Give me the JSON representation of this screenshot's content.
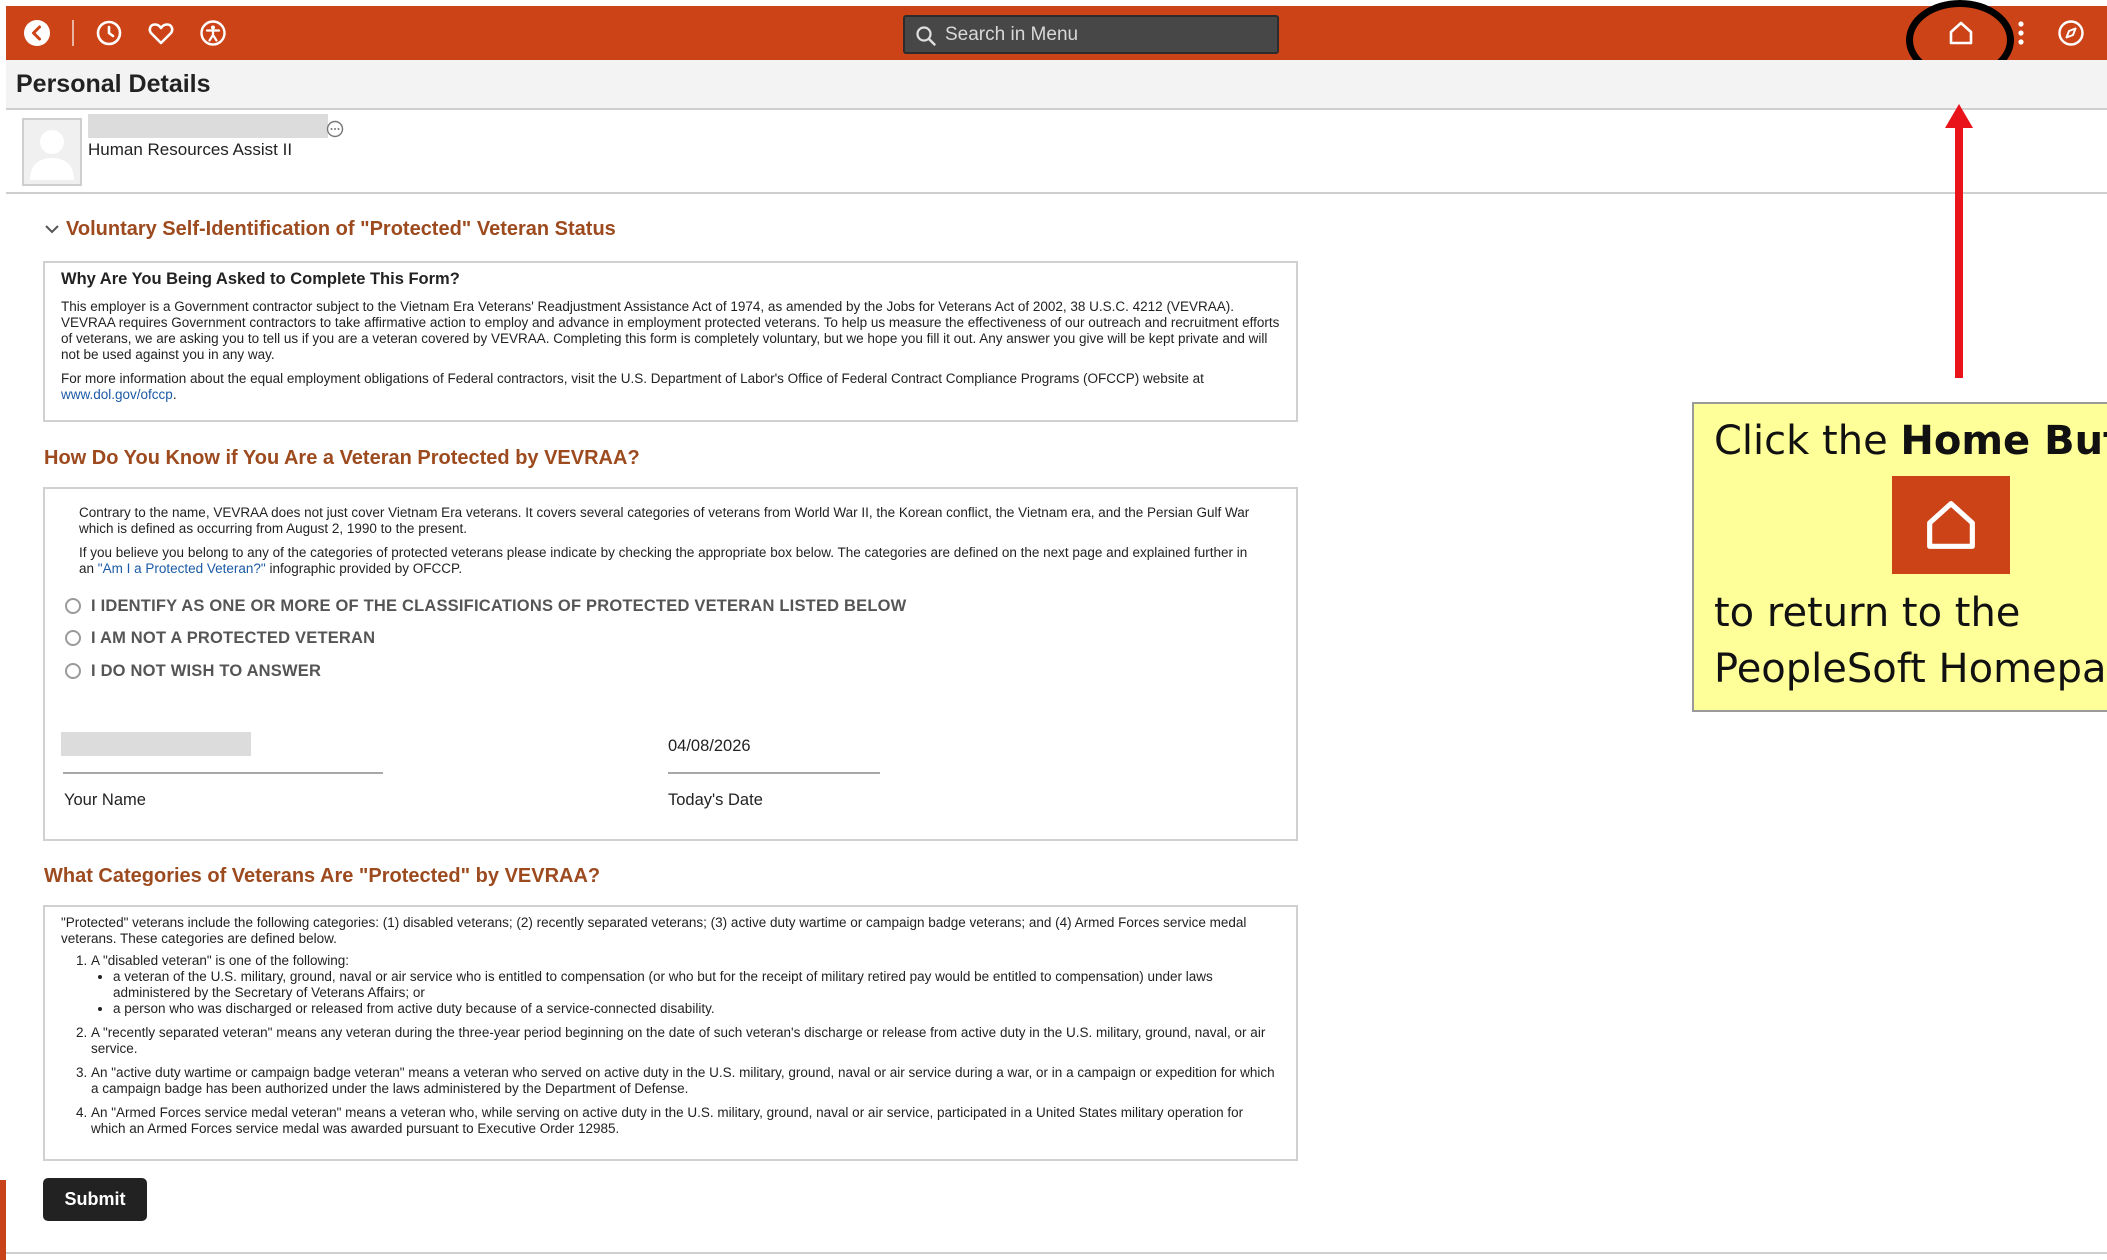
{
  "header": {
    "search_placeholder": "Search in Menu"
  },
  "page": {
    "title": "Personal Details",
    "job_title": "Human Resources Assist II"
  },
  "section1": {
    "heading": "Voluntary Self-Identification of \"Protected\" Veteran Status",
    "box_title": "Why Are You Being Asked to Complete This Form?",
    "para1": "This employer is a Government contractor subject to the Vietnam Era Veterans' Readjustment Assistance Act of 1974, as amended by the Jobs for Veterans Act of 2002, 38 U.S.C. 4212 (VEVRAA). VEVRAA requires Government contractors to take affirmative action to employ and advance in employment protected veterans. To help us measure the effectiveness of our outreach and recruitment efforts of veterans, we are asking you to tell us if you are a veteran covered by VEVRAA. Completing this form is completely voluntary, but we hope you fill it out. Any answer you give will be kept private and will not be used against you in any way.",
    "para2_pre": "For more information about the equal employment obligations of Federal contractors, visit the U.S. Department of Labor's Office of Federal Contract Compliance Programs (OFCCP) website at ",
    "para2_link": "www.dol.gov/ofccp",
    "para2_post": "."
  },
  "section2": {
    "heading": "How Do You Know if You Are a Veteran Protected by VEVRAA?",
    "para1": "Contrary to the name, VEVRAA does not just cover Vietnam Era veterans. It covers several categories of veterans from World War II, the Korean conflict, the Vietnam era, and the Persian Gulf War which is defined as occurring from August 2, 1990 to the present.",
    "para2_pre": "If you believe you belong to any of the categories of protected veterans please indicate by checking the appropriate box below. The categories are defined on the next page and explained further in an ",
    "para2_link": "\"Am I a Protected Veteran?\"",
    "para2_post": " infographic provided by OFCCP.",
    "options": [
      "I IDENTIFY AS ONE OR MORE OF THE CLASSIFICATIONS OF PROTECTED VETERAN LISTED BELOW",
      "I AM NOT A PROTECTED VETERAN",
      "I DO NOT WISH TO ANSWER"
    ],
    "date_value": "04/08/2026",
    "name_label": "Your Name",
    "date_label": "Today's Date"
  },
  "section3": {
    "heading": "What Categories of Veterans Are \"Protected\" by VEVRAA?",
    "intro": "\"Protected\" veterans include the following categories: (1) disabled veterans; (2) recently separated veterans; (3) active duty wartime or campaign badge veterans; and (4) Armed Forces service medal veterans. These categories are defined below.",
    "item1": "A \"disabled veteran\" is one of the following:",
    "item1_bullets": [
      "a veteran of the U.S. military, ground, naval or air service who is entitled to compensation (or who but for the receipt of military retired pay would be entitled to compensation) under laws administered by the Secretary of Veterans Affairs; or",
      "a person who was discharged or released from active duty because of a service-connected disability."
    ],
    "item2": "A \"recently separated veteran\" means any veteran during the three-year period beginning on the date of such veteran's discharge or release from active duty in the U.S. military, ground, naval, or air service.",
    "item3": "An \"active duty wartime or campaign badge veteran\" means a veteran who served on active duty in the U.S. military, ground, naval or air service during a war, or in a campaign or expedition for which a campaign badge has been authorized under the laws administered by the Department of Defense.",
    "item4": "An \"Armed Forces service medal veteran\" means a veteran who, while serving on active duty in the U.S. military, ground, naval or air service, participated in a United States military operation for which an Armed Forces service medal was awarded pursuant to Executive Order 12985."
  },
  "actions": {
    "submit_label": "Submit"
  },
  "annotation": {
    "line1_pre": "Click the ",
    "line1_bold": "Home Button",
    "line2": "to return to the",
    "line3": "PeopleSoft Homepage"
  },
  "colors": {
    "brand_orange": "#cb4317",
    "heading_brown": "#9c4a1e",
    "callout_yellow": "#ffff99",
    "arrow_red": "#e8141a"
  },
  "icons": [
    "back-icon",
    "history-icon",
    "favorites-icon",
    "accessibility-icon",
    "search-icon",
    "home-icon",
    "kebab-menu-icon",
    "navigator-compass-icon",
    "more-options-icon",
    "avatar-icon",
    "chevron-down-icon"
  ]
}
